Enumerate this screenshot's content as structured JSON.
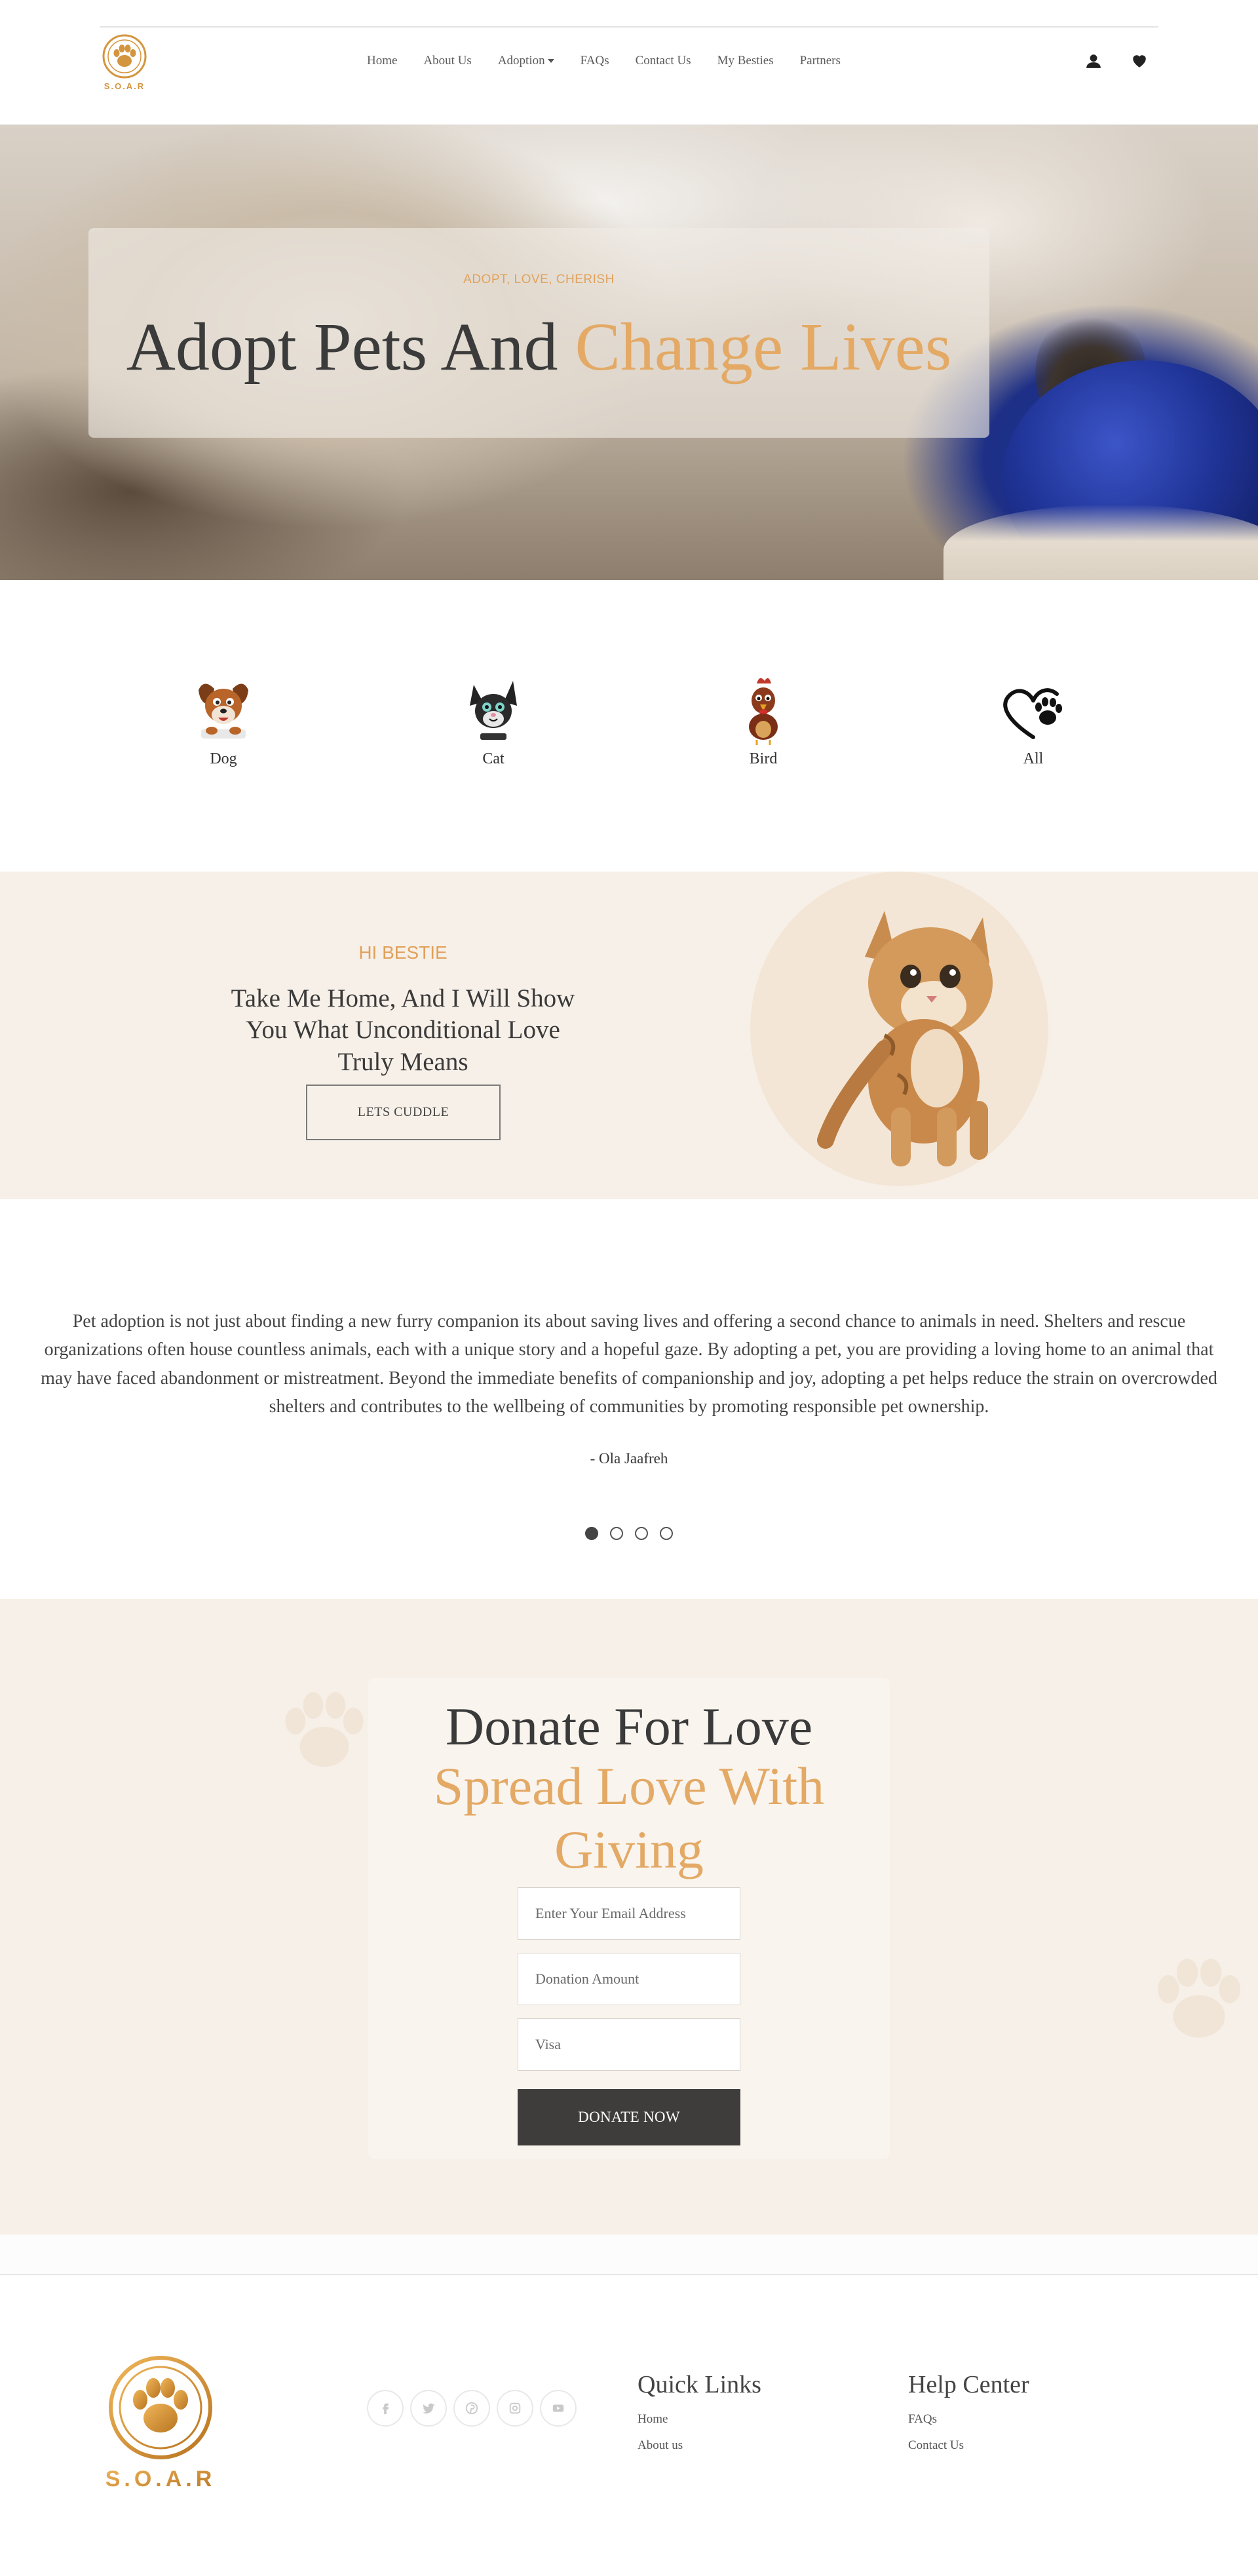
{
  "brand": {
    "name": "S.O.A.R"
  },
  "nav": {
    "items": [
      {
        "label": "Home"
      },
      {
        "label": "About Us"
      },
      {
        "label": "Adoption",
        "dropdown": true
      },
      {
        "label": "FAQs"
      },
      {
        "label": "Contact Us"
      },
      {
        "label": "My Besties"
      },
      {
        "label": "Partners"
      }
    ],
    "icons": [
      "user-icon",
      "heart-icon"
    ]
  },
  "hero": {
    "kicker": "ADOPT, LOVE, CHERISH",
    "title_main": "Adopt Pets And ",
    "title_accent": "Change Lives"
  },
  "categories": [
    {
      "label": "Dog",
      "icon": "dog-icon"
    },
    {
      "label": "Cat",
      "icon": "cat-icon"
    },
    {
      "label": "Bird",
      "icon": "bird-icon"
    },
    {
      "label": "All",
      "icon": "heart-paw-icon"
    }
  ],
  "bestie": {
    "kicker": "HI BESTIE",
    "text": "Take Me Home, And I Will Show You What Unconditional Love Truly Means",
    "button": "LETS CUDDLE"
  },
  "testimonial": {
    "text": "Pet adoption is not just about finding a new furry companion its about saving lives and offering a second chance to animals in need. Shelters and rescue organizations often house countless animals, each with a unique story and a hopeful gaze. By adopting a pet, you are providing a loving home to an animal that may have faced abandonment or mistreatment. Beyond the immediate benefits of companionship and joy, adopting a pet helps reduce the strain on overcrowded shelters and contributes to the wellbeing of communities by promoting responsible pet ownership.",
    "author": "- Ola Jaafreh",
    "slides": 4,
    "active_slide": 1
  },
  "donate": {
    "title": "Donate For Love",
    "subtitle": "Spread Love With Giving",
    "email_placeholder": "Enter Your Email Address",
    "amount_placeholder": "Donation Amount",
    "card_placeholder": "Visa",
    "button": "DONATE NOW"
  },
  "footer": {
    "socials": [
      "facebook-icon",
      "twitter-icon",
      "pinterest-icon",
      "instagram-icon",
      "youtube-icon"
    ],
    "quick_links": {
      "title": "Quick Links",
      "links": [
        {
          "label": "Home"
        },
        {
          "label": "About us"
        }
      ]
    },
    "help_center": {
      "title": "Help Center",
      "links": [
        {
          "label": "FAQs"
        },
        {
          "label": "Contact Us"
        }
      ]
    }
  },
  "colors": {
    "accent": "#e3a965",
    "cream": "#f7f0e8",
    "dark": "#3f3d3b"
  }
}
